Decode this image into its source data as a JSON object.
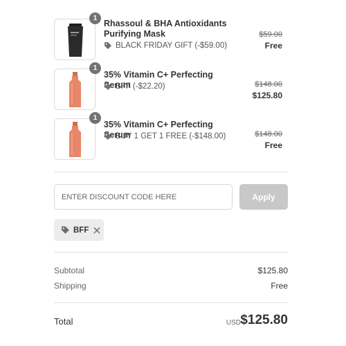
{
  "cart": {
    "items": [
      {
        "qty": "1",
        "name": "Rhassoul & BHA Antioxidants Purifying Mask",
        "discount_label": "BLACK FRIDAY GIFT (-$59.00)",
        "original_price": "$59.00",
        "final_price": "Free",
        "image": "dark-tube-product"
      },
      {
        "qty": "1",
        "name": "35% Vitamin C+ Perfecting Serum",
        "discount_label": "BFF (-$22.20)",
        "original_price": "$148.00",
        "final_price": "$125.80",
        "image": "orange-serum-bottle"
      },
      {
        "qty": "1",
        "name": "35% Vitamin C+ Perfecting Serum",
        "discount_label": "BUY 1 GET 1 FREE (-$148.00)",
        "original_price": "$148.00",
        "final_price": "Free",
        "image": "orange-serum-bottle"
      }
    ]
  },
  "discount": {
    "placeholder": "ENTER DISCOUNT CODE HERE",
    "apply_label": "Apply",
    "applied_code": "BFF"
  },
  "summary": {
    "subtotal_label": "Subtotal",
    "subtotal_value": "$125.80",
    "shipping_label": "Shipping",
    "shipping_value": "Free",
    "total_label": "Total",
    "currency": "USD",
    "total_value": "$125.80"
  },
  "colors": {
    "badge": "#737373",
    "apply_disabled": "#c8c8c8",
    "chip_bg": "#ececec",
    "serum": "#e8866a",
    "mask_tube": "#2b2b2b"
  }
}
